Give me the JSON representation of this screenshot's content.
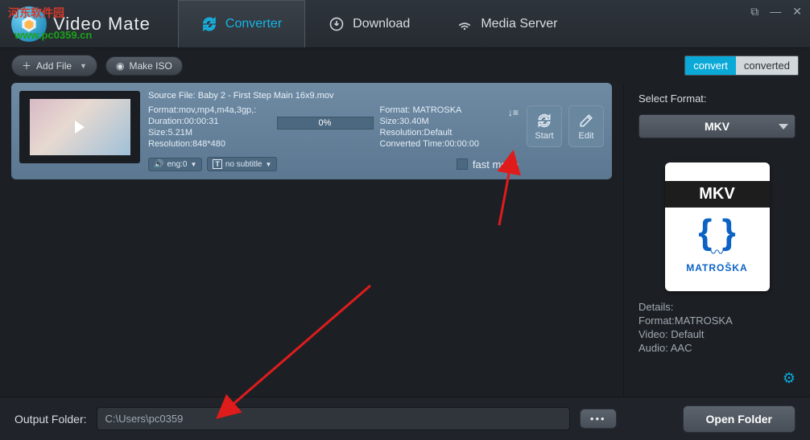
{
  "app": {
    "name": "Video Mate"
  },
  "overlay": {
    "t1": "河东软件园",
    "t2": "www.pc0359.cn"
  },
  "nav": {
    "converter": "Converter",
    "download": "Download",
    "media_server": "Media Server"
  },
  "toolbar": {
    "add_file": "Add File",
    "make_iso": "Make ISO",
    "tab_convert": "convert",
    "tab_converted": "converted"
  },
  "file": {
    "source_prefix": "Source File: ",
    "source_name": "Baby 2 - First Step Main 16x9.mov",
    "left": {
      "format": "Format:mov,mp4,m4a,3gp,:",
      "duration": "Duration:00:00:31",
      "size": "Size:5.21M",
      "resolution": "Resolution:848*480"
    },
    "right": {
      "format": "Format: MATROSKA",
      "size": "Size:30.40M",
      "resolution": "Resolution:Default",
      "converted_time": "Converted Time:00:00:00"
    },
    "progress": "0%",
    "audio_sel": "eng:0",
    "subtitle_sel": "no subtitle",
    "fast_mode": "fast mode",
    "start": "Start",
    "edit": "Edit"
  },
  "sidebar": {
    "select_format": "Select Format:",
    "format_name": "MKV",
    "preview_top": "MKV",
    "preview_brand": "MATROŠKA",
    "details_label": "Details:",
    "details_format": "Format:MATROSKA",
    "details_video": "Video: Default",
    "details_audio": "Audio: AAC"
  },
  "footer": {
    "label": "Output Folder:",
    "path": "C:\\Users\\pc0359",
    "open": "Open Folder"
  }
}
